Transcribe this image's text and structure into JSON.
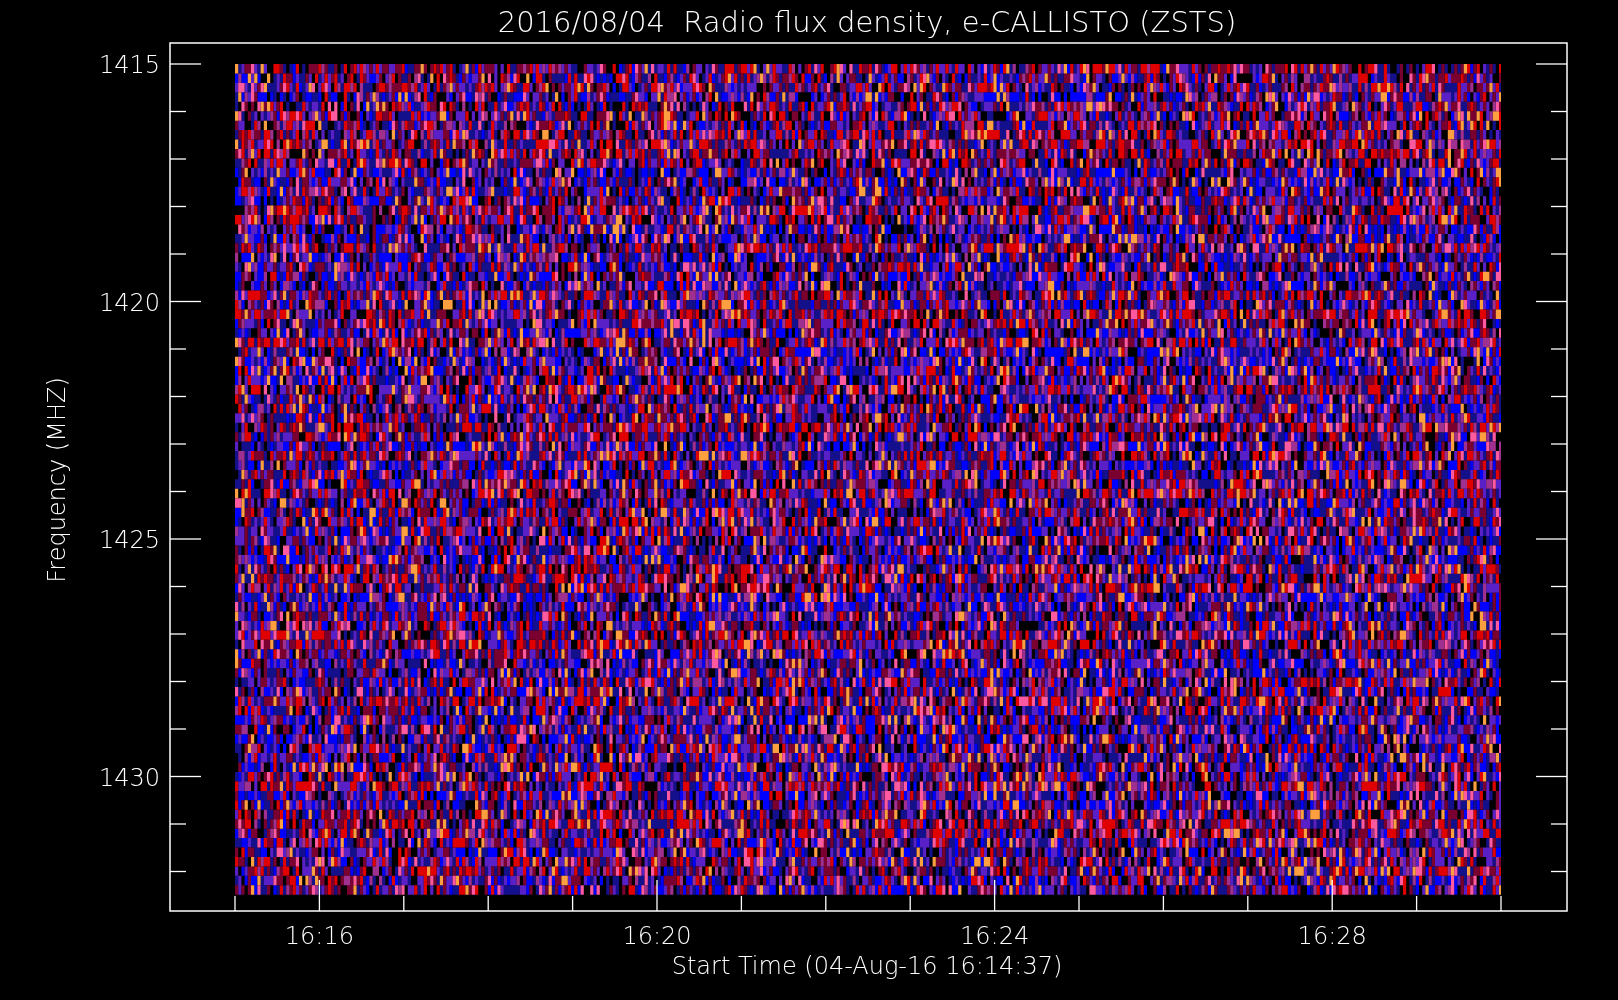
{
  "title": "2016/08/04  Radio flux density, e-CALLISTO (ZSTS)",
  "y_axis": {
    "label": "Frequency (MHZ)",
    "ticks": [
      "1415",
      "1420",
      "1425",
      "1430"
    ]
  },
  "x_axis": {
    "label": "Start Time (04-Aug-16 16:14:37)",
    "ticks": [
      "16:16",
      "16:20",
      "16:24",
      "16:28"
    ]
  }
}
